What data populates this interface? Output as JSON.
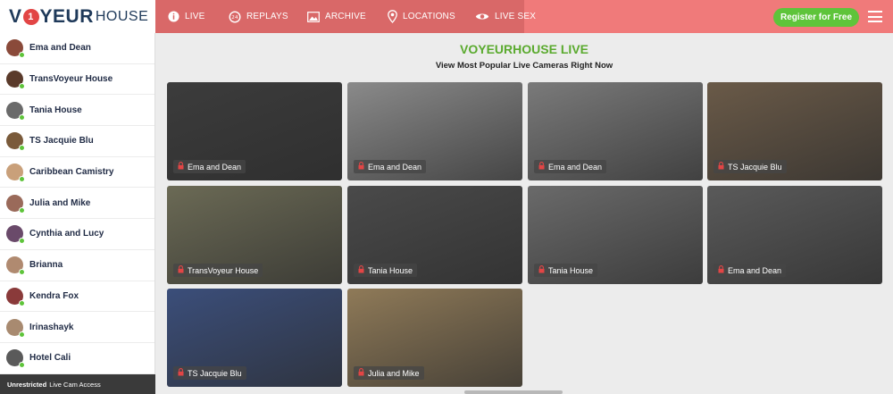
{
  "header": {
    "logo_main_a": "V",
    "logo_o": "1",
    "logo_main_b": "YEUR",
    "logo_sub": "HOUSE",
    "nav": [
      {
        "label": "LIVE",
        "icon": "info-circle-icon"
      },
      {
        "label": "REPLAYS",
        "icon": "replay-24-icon"
      },
      {
        "label": "ARCHIVE",
        "icon": "image-icon"
      },
      {
        "label": "LOCATIONS",
        "icon": "map-pin-icon"
      },
      {
        "label": "LIVE SEX",
        "icon": "eye-icon"
      }
    ],
    "register_label": "Register for Free",
    "accent_color": "#f07a7a",
    "register_color": "#5ec43a"
  },
  "sidebar": {
    "items": [
      {
        "name": "Ema and Dean",
        "avatar_color": "#8a4a3a"
      },
      {
        "name": "TransVoyeur House",
        "avatar_color": "#5a3a2a"
      },
      {
        "name": "Tania House",
        "avatar_color": "#6a6a6a"
      },
      {
        "name": "TS Jacquie Blu",
        "avatar_color": "#7a5a3a"
      },
      {
        "name": "Caribbean Camistry",
        "avatar_color": "#c9a07a"
      },
      {
        "name": "Julia and Mike",
        "avatar_color": "#9a6a5a"
      },
      {
        "name": "Cynthia and Lucy",
        "avatar_color": "#6a4a6a"
      },
      {
        "name": "Brianna",
        "avatar_color": "#b08a70"
      },
      {
        "name": "Kendra Fox",
        "avatar_color": "#8a3a3a"
      },
      {
        "name": "Irinashayk",
        "avatar_color": "#a88a70"
      },
      {
        "name": "Hotel Cali",
        "avatar_color": "#5a5a5a"
      }
    ],
    "footer_bold": "Unrestricted",
    "footer_text": "Live Cam Access"
  },
  "main": {
    "title": "VOYEURHOUSE LIVE",
    "subtitle": "View Most Popular Live Cameras Right Now",
    "tiles": [
      {
        "label": "Ema and Dean",
        "bg": "#3c3c3c"
      },
      {
        "label": "Ema and Dean",
        "bg": "#8a8a8a"
      },
      {
        "label": "Ema and Dean",
        "bg": "#7a7a7a"
      },
      {
        "label": "TS Jacquie Blu",
        "bg": "#6a5a48"
      },
      {
        "label": "TransVoyeur House",
        "bg": "#6b6a55"
      },
      {
        "label": "Tania House",
        "bg": "#4a4a4a"
      },
      {
        "label": "Tania House",
        "bg": "#6a6a6a"
      },
      {
        "label": "Ema and Dean",
        "bg": "#5a5a5a"
      },
      {
        "label": "TS Jacquie Blu",
        "bg": "#3b4e7a"
      },
      {
        "label": "Julia and Mike",
        "bg": "#8f7a58"
      }
    ]
  }
}
